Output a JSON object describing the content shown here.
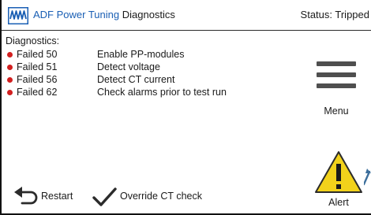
{
  "header": {
    "brand_primary": "ADF Power Tuning",
    "brand_secondary": "Diagnostics",
    "status": "Status: Tripped",
    "logo_icon": "waveform-logo-icon",
    "brand_color": "#1a5fb4"
  },
  "diagnostics": {
    "title": "Diagnostics:",
    "status_color": "#d21f1f",
    "items": [
      {
        "code": "Failed 50",
        "description": "Enable PP-modules"
      },
      {
        "code": "Failed 51",
        "description": "Detect voltage"
      },
      {
        "code": "Failed 56",
        "description": "Detect CT current"
      },
      {
        "code": "Failed 62",
        "description": "Check alarms prior to test run"
      }
    ]
  },
  "menu": {
    "label": "Menu",
    "icon": "hamburger-menu-icon"
  },
  "actions": {
    "restart_label": "Restart",
    "restart_icon": "back-arrow-icon",
    "override_label": "Override CT check",
    "override_icon": "checkmark-icon"
  },
  "alert": {
    "label": "Alert",
    "icon": "warning-triangle-icon",
    "color": "#f2d21b"
  }
}
